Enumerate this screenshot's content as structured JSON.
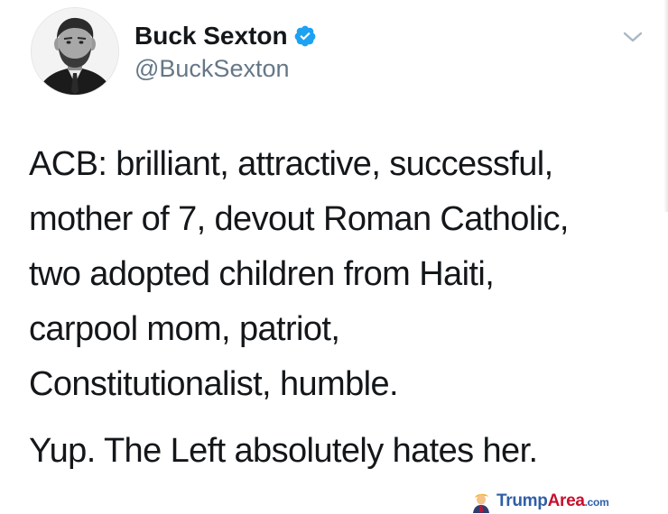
{
  "user": {
    "display_name": "Buck Sexton",
    "handle": "@BuckSexton",
    "verified": true
  },
  "tweet": {
    "lines": [
      "ACB: brilliant, attractive, successful,",
      "mother of 7, devout Roman Catholic,",
      "two adopted children from Haiti,",
      "carpool mom, patriot,",
      "Constitutionalist, humble.",
      "Yup. The Left absolutely hates her."
    ]
  },
  "watermark": {
    "part1": "Trump",
    "part2": "Area",
    "part3": ".com"
  },
  "icons": {
    "verified": "verified-badge-icon",
    "menu": "chevron-down-icon",
    "watermark_figure": "trump-figure-icon"
  },
  "colors": {
    "verified_blue": "#1da1f2",
    "handle_gray": "#657786",
    "text_dark": "#14171a",
    "chevron_gray": "#aab8c2",
    "watermark_blue": "#2f5ea8",
    "watermark_red": "#c8102e"
  }
}
